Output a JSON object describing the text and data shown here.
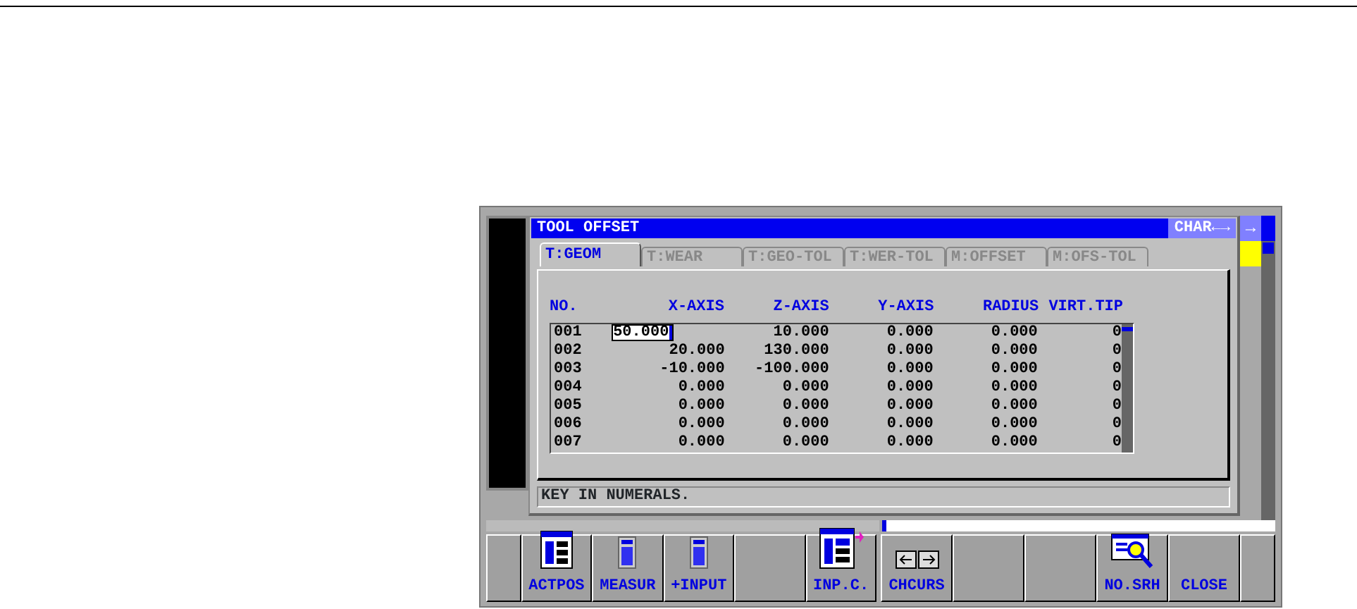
{
  "dialog": {
    "title": "TOOL OFFSET",
    "mode": "CHAR←→"
  },
  "side_button": "→",
  "tabs": [
    {
      "label": "T:GEOM",
      "selected": true
    },
    {
      "label": "T:WEAR",
      "selected": false
    },
    {
      "label": "T:GEO-TOL",
      "selected": false
    },
    {
      "label": "T:WER-TOL",
      "selected": false
    },
    {
      "label": "M:OFFSET",
      "selected": false
    },
    {
      "label": "M:OFS-TOL",
      "selected": false
    }
  ],
  "table": {
    "columns": [
      "NO.",
      "X-AXIS",
      "Z-AXIS",
      "Y-AXIS",
      "RADIUS",
      "VIRT.TIP"
    ],
    "rows": [
      {
        "cells": [
          "001",
          "50.000",
          "10.000",
          "0.000",
          "0.000",
          "0"
        ],
        "editing": true
      },
      {
        "cells": [
          "002",
          "20.000",
          "130.000",
          "0.000",
          "0.000",
          "0"
        ],
        "editing": false
      },
      {
        "cells": [
          "003",
          "-10.000",
          "-100.000",
          "0.000",
          "0.000",
          "0"
        ],
        "editing": false
      },
      {
        "cells": [
          "004",
          "0.000",
          "0.000",
          "0.000",
          "0.000",
          "0"
        ],
        "editing": false
      },
      {
        "cells": [
          "005",
          "0.000",
          "0.000",
          "0.000",
          "0.000",
          "0"
        ],
        "editing": false
      },
      {
        "cells": [
          "006",
          "0.000",
          "0.000",
          "0.000",
          "0.000",
          "0"
        ],
        "editing": false
      },
      {
        "cells": [
          "007",
          "0.000",
          "0.000",
          "0.000",
          "0.000",
          "0"
        ],
        "editing": false
      }
    ]
  },
  "message": "KEY IN NUMERALS.",
  "softkeys_left": [
    {
      "kind": "edge"
    },
    {
      "kind": "key",
      "label": "ACTPOS"
    },
    {
      "kind": "key",
      "label": "MEASUR"
    },
    {
      "kind": "key",
      "label": "+INPUT"
    },
    {
      "kind": "blank"
    },
    {
      "kind": "key",
      "label": "INP.C."
    }
  ],
  "softkeys_right": [
    {
      "kind": "key",
      "label": "CHCURS"
    },
    {
      "kind": "blank"
    },
    {
      "kind": "blank"
    },
    {
      "kind": "key",
      "label": "NO.SRH"
    },
    {
      "kind": "key",
      "label": "CLOSE"
    },
    {
      "kind": "edge"
    }
  ]
}
